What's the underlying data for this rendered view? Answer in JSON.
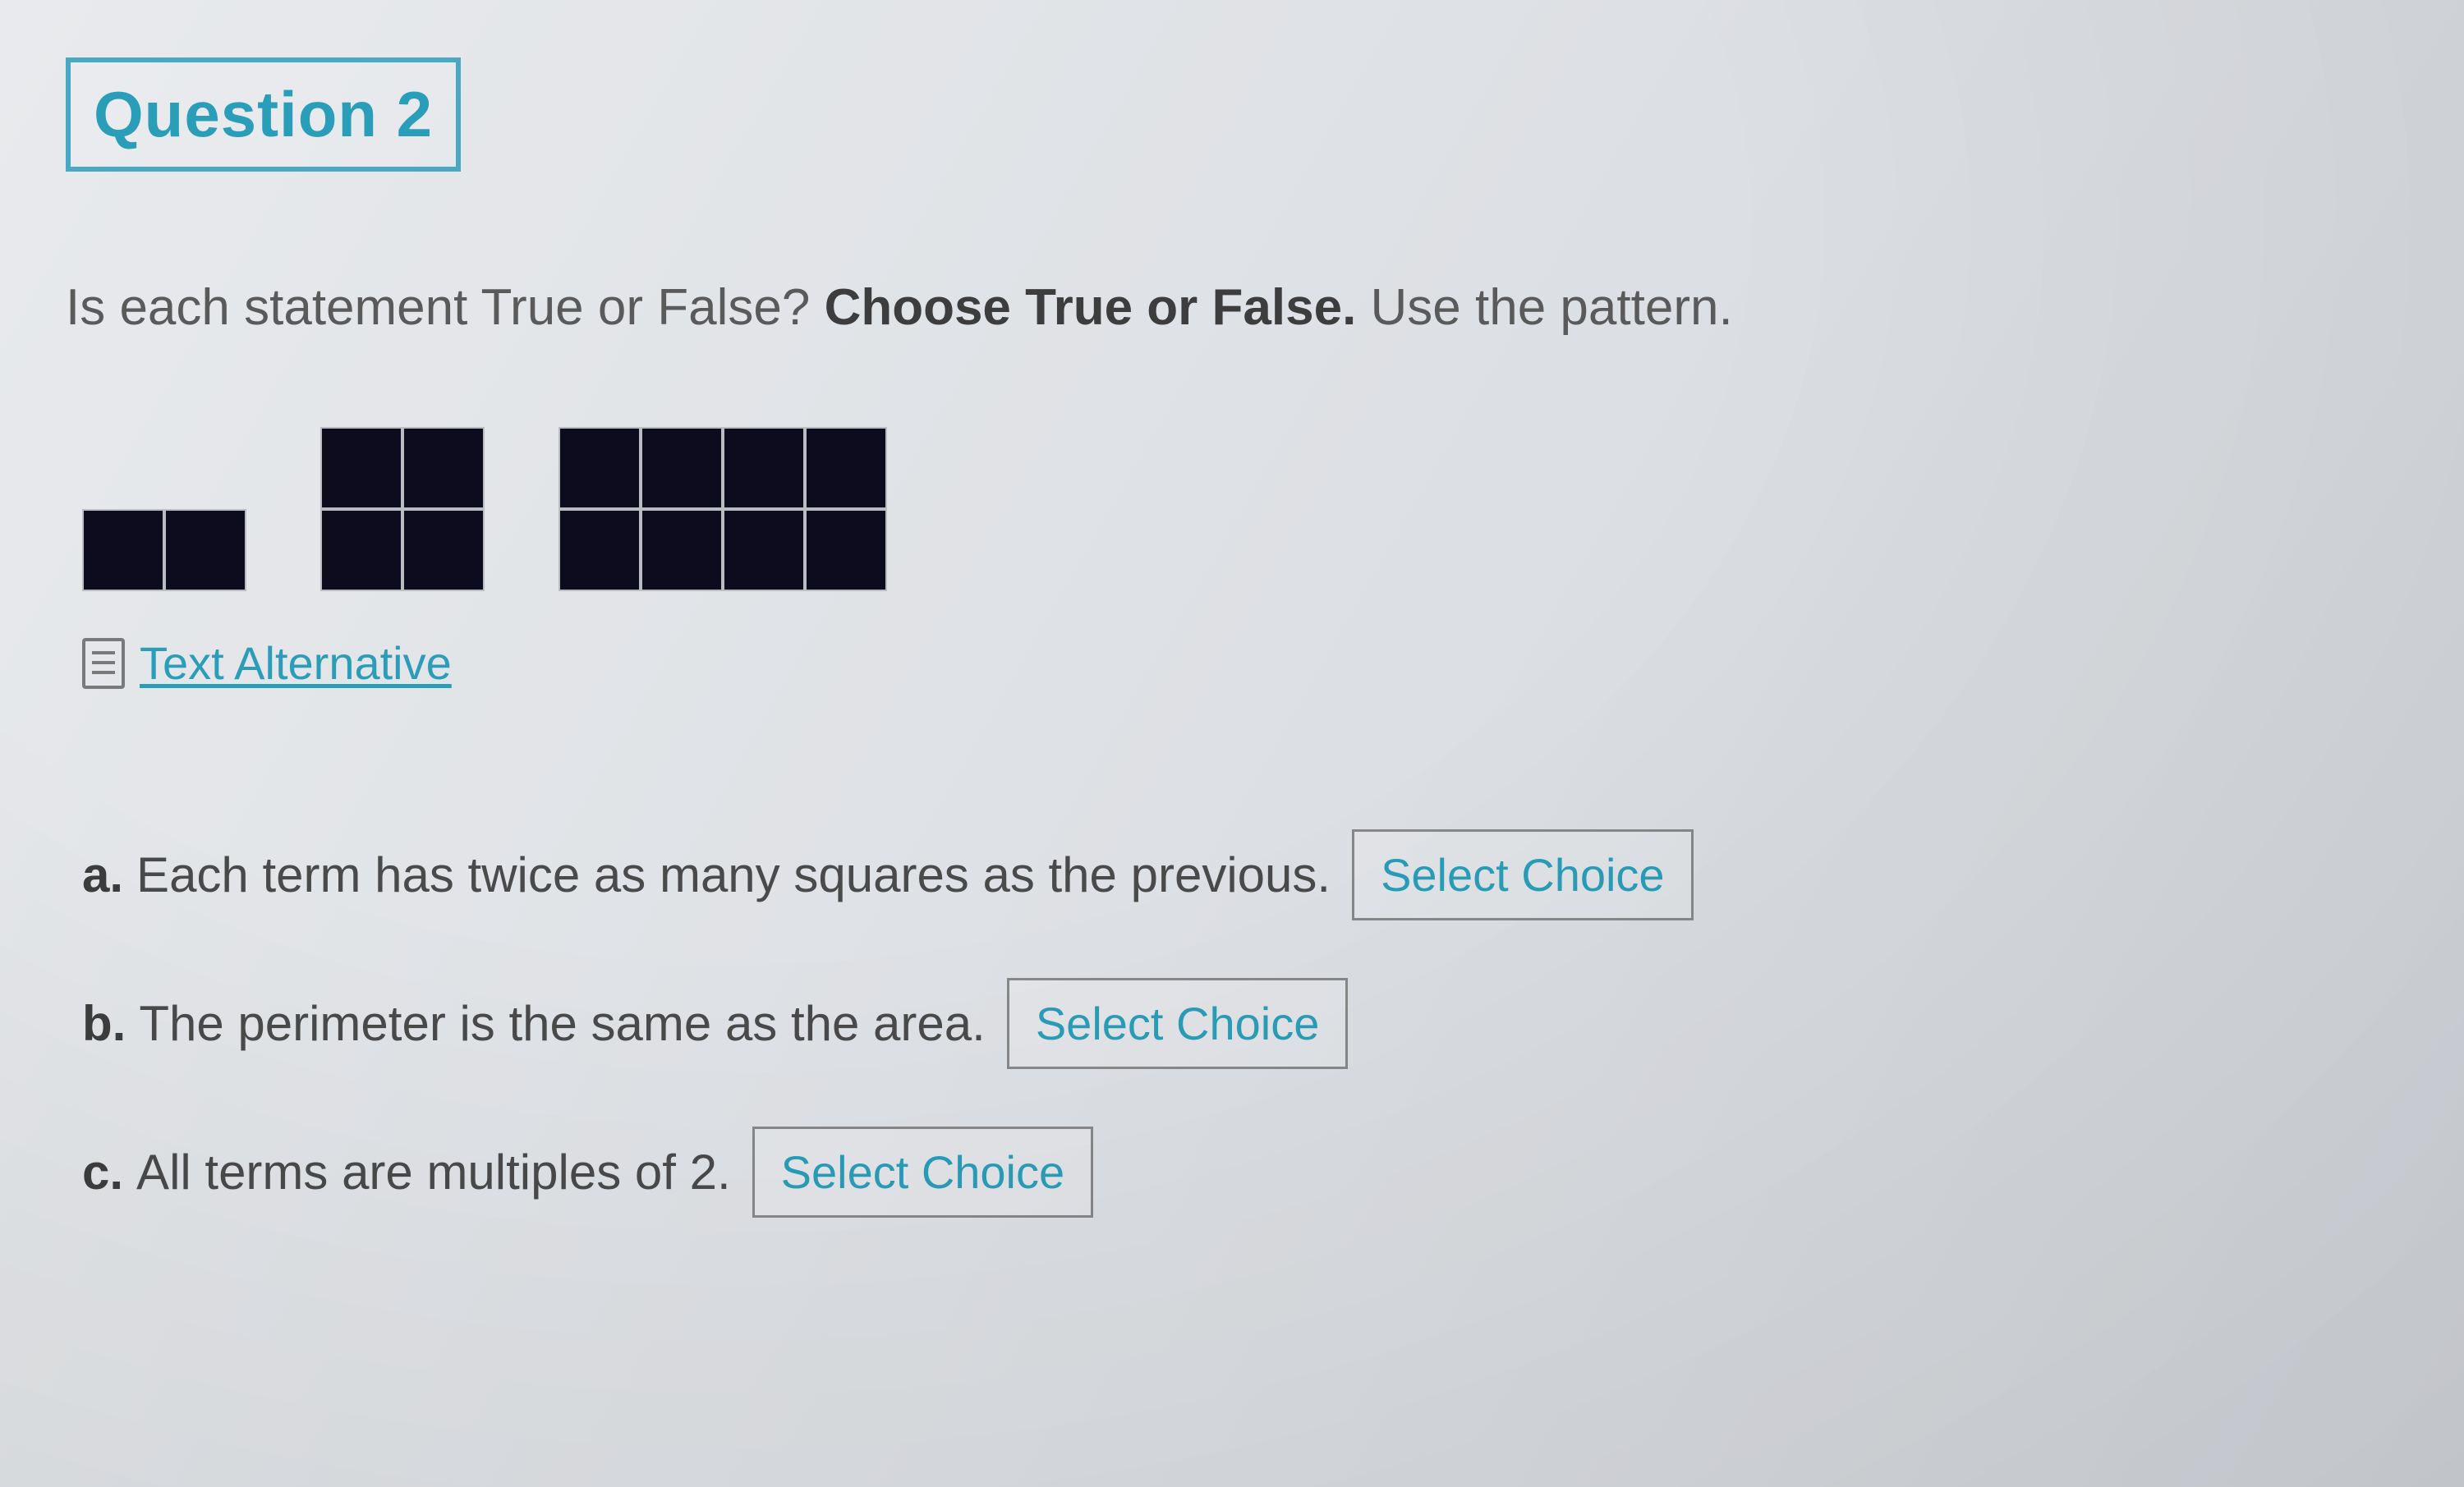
{
  "question": {
    "badge": "Question 2",
    "prompt_pre": "Is each statement True or False? ",
    "prompt_bold": "Choose True or False.",
    "prompt_post": " Use the pattern."
  },
  "text_alternative": {
    "label": "Text Alternative"
  },
  "pattern": {
    "figures": [
      {
        "rows": 1,
        "cols": 2
      },
      {
        "rows": 2,
        "cols": 2
      },
      {
        "rows": 2,
        "cols": 4
      }
    ]
  },
  "items": [
    {
      "label": "a.",
      "text": "Each term has twice as many squares as the previous.",
      "select_placeholder": "Select Choice"
    },
    {
      "label": "b.",
      "text": "The perimeter is the same as the area.",
      "select_placeholder": "Select Choice"
    },
    {
      "label": "c.",
      "text": "All terms are multiples of 2.",
      "select_placeholder": "Select Choice"
    }
  ]
}
